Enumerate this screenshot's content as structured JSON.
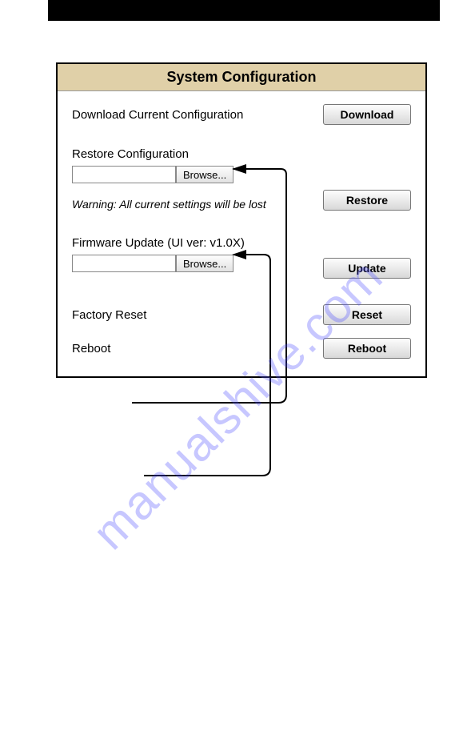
{
  "panel": {
    "title": "System Configuration",
    "download": {
      "label": "Download Current Configuration",
      "button": "Download"
    },
    "restore": {
      "label": "Restore Configuration",
      "browse_button": "Browse...",
      "input_value": "",
      "warning": "Warning: All current settings will be lost",
      "button": "Restore"
    },
    "firmware": {
      "label": "Firmware Update (UI ver: v1.0X)",
      "browse_button": "Browse...",
      "input_value": "",
      "button": "Update"
    },
    "factory_reset": {
      "label": "Factory Reset",
      "button": "Reset"
    },
    "reboot": {
      "label": "Reboot",
      "button": "Reboot"
    }
  },
  "watermark": "manualshive.com"
}
